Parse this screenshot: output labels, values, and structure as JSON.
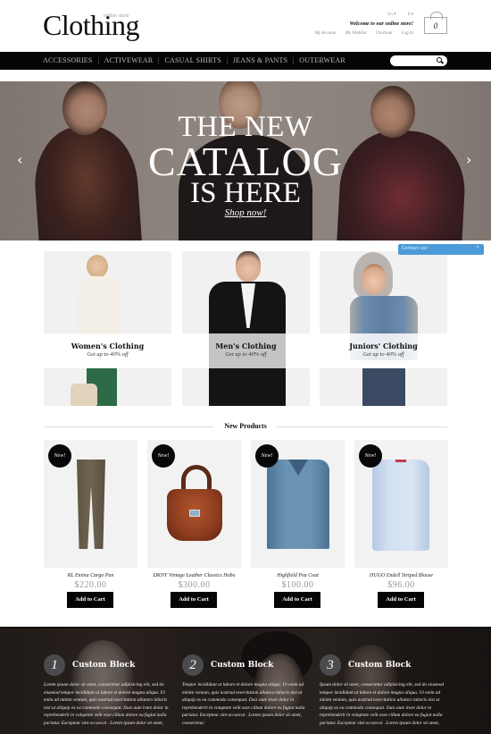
{
  "header": {
    "logo": "Clothing",
    "logo_tagline": "online store",
    "language": "En",
    "currency": "$",
    "welcome": "Welcome to our online store!",
    "links": [
      "My Account",
      "My Wishlist",
      "Checkout",
      "Log In"
    ],
    "cart_count": "0"
  },
  "nav": {
    "items": [
      "ACCESSORIES",
      "ACTIVEWEAR",
      "CASUAL SHIRTS",
      "JEANS & PANTS",
      "OUTERWEAR"
    ],
    "search_placeholder": ""
  },
  "hero": {
    "line1": "THE NEW",
    "line2": "CATALOG",
    "line3": "IS HERE",
    "link": "Shop now!",
    "prev_icon": "‹",
    "next_icon": "›"
  },
  "contact": {
    "label": "Contact us!",
    "chevron": "⌃",
    "color": "#4a9bd7"
  },
  "categories": [
    {
      "title": "Women's Clothing",
      "subtitle": "Get up to 40% off"
    },
    {
      "title": "Men's Clothing",
      "subtitle": "Get up to 40% off"
    },
    {
      "title": "Juniors' Clothing",
      "subtitle": "Get up to 40% off"
    }
  ],
  "new_products": {
    "title": "New Products",
    "items": [
      {
        "badge": "New!",
        "name": "RL Emina Cargo Pan",
        "price": "$220.00",
        "button": "Add to Cart"
      },
      {
        "badge": "New!",
        "name": "DKNY Vintage Leather Classics Hobo",
        "price": "$300.00",
        "button": "Add to Cart"
      },
      {
        "badge": "New!",
        "name": "Highfield Pea Coat",
        "price": "$100.00",
        "button": "Add to Cart"
      },
      {
        "badge": "New!",
        "name": "HUGO Endell Striped Blouse",
        "price": "$96.00",
        "button": "Add to Cart"
      }
    ]
  },
  "custom_blocks": [
    {
      "number": "1",
      "title": "Custom Block",
      "text": "Lorem ipsum dolor sit amet, consectetur adipisicing elit, sed do eiusmod tempor incididunt ut labore et dolore magna aliqua. Ut enim ad minim veniam, quis nostrud exercitation ullamco laboris nisi ut aliquip ex ea commodo consequat. Duis aute irure dolor in reprehenderit in voluptate velit esse cillum dolore eu fugiat nulla pariatur. Excepteur sint occaecat . Lorem ipsum dolor sit amet,"
    },
    {
      "number": "2",
      "title": "Custom Block",
      "text": "Tempor incididunt ut labore et dolore magna aliqua. Ut enim ad minim veniam, quis nostrud exercitation ullamco laboris nisi ut aliquip ex ea commodo consequat. Duis aute irure dolor in reprehenderit in voluptate velit esse cillum dolore eu fugiat nulla pariatur. Excepteur sint occaecat . Lorem ipsum dolor sit amet, consectetur."
    },
    {
      "number": "3",
      "title": "Custom Block",
      "text": "Ipsum dolor sit amet, consectetur adipisicing elit, sed do eiusmod tempor incididunt ut labore et dolore magna aliqua. Ut enim ad minim veniam, quis nostrud exercitation ullamco laboris nisi ut aliquip ex ea commodo consequat. Duis aute irure dolor in reprehenderit in voluptate velit esse cillum dolore eu fugiat nulla pariatur. Excepteur sint occaecat . Lorem ipsum dolor sit amet,"
    }
  ]
}
